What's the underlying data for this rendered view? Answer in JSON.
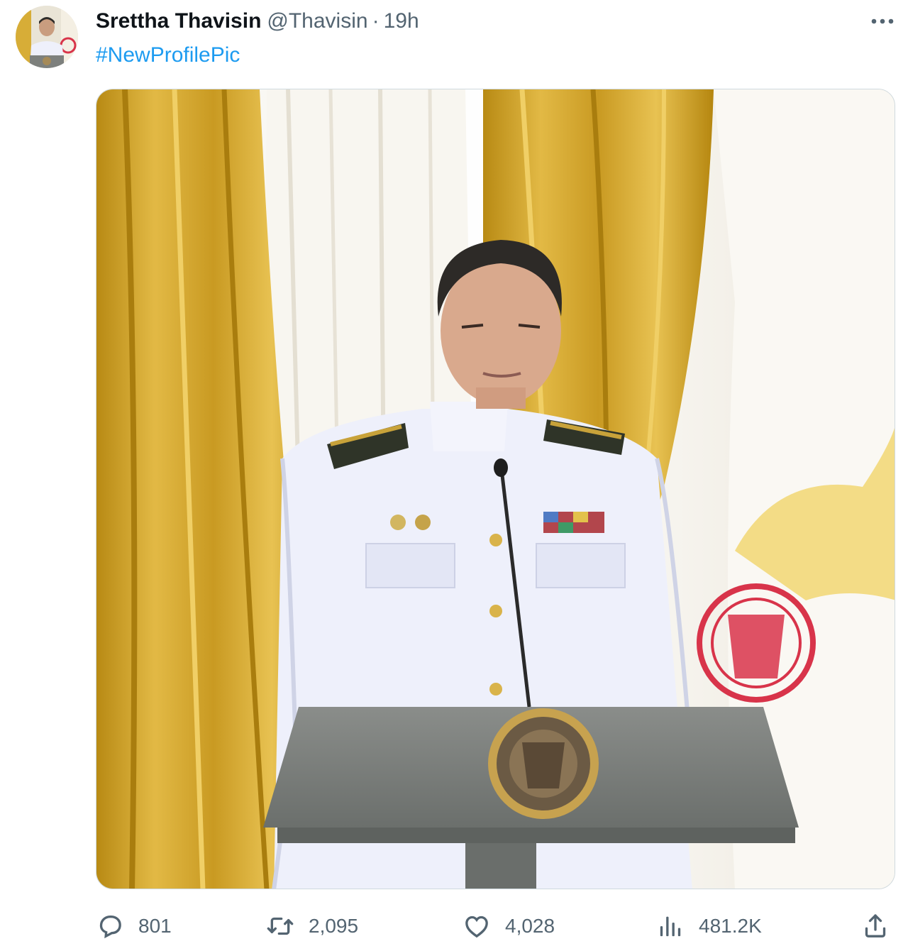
{
  "tweet": {
    "display_name": "Srettha Thavisin",
    "handle": "@Thavisin",
    "separator": "·",
    "time": "19h",
    "text": "#NewProfilePic",
    "avatar_icon": "profile-avatar",
    "more_icon": "more-horizontal-icon",
    "media_description_icon": "photo-icon"
  },
  "actions": {
    "replies": {
      "icon": "reply-icon",
      "count": "801"
    },
    "retweets": {
      "icon": "retweet-icon",
      "count": "2,095"
    },
    "likes": {
      "icon": "heart-icon",
      "count": "4,028"
    },
    "views": {
      "icon": "analytics-icon",
      "count": "481.2K"
    },
    "share": {
      "icon": "share-icon"
    }
  },
  "colors": {
    "link": "#1d9bf0",
    "secondary_text": "#536471",
    "primary_text": "#0f1419",
    "border": "#cfd9de",
    "curtain_gold": "#d4a628",
    "uniform_white": "#eef0fb",
    "podium_gray": "#7c807d",
    "seal_red": "#d8344a"
  }
}
